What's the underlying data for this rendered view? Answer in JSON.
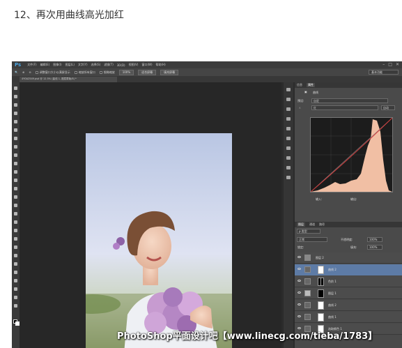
{
  "heading": "12、再次用曲线高光加红",
  "ps": {
    "logo": "Ps",
    "menu": [
      "文件(F)",
      "编辑(E)",
      "图像(I)",
      "图层(L)",
      "文字(Y)",
      "选择(S)",
      "滤镜(T)",
      "3D(D)",
      "视图(V)",
      "窗口(W)",
      "帮助(H)"
    ],
    "window_buttons": [
      "–",
      "□",
      "✕"
    ],
    "options": {
      "check1": "调整窗口大小以满屏显示",
      "check2": "缩放所有窗口",
      "check3": "细微缩放",
      "btn1": "100%",
      "btn2": "适合屏幕",
      "btn3": "填充屏幕",
      "workspace": "基本功能"
    },
    "doc_tab": "4Y0A2549.psd @ 12.5% (曲线 1, 图层蒙版/8) *",
    "properties": {
      "tabs": [
        "信息",
        "属性"
      ],
      "title": "曲线",
      "preset_label": "预设:",
      "preset_value": "自定",
      "channel_value": "红",
      "auto_button": "自动",
      "input_label": "输入:",
      "output_label": "输出:"
    },
    "layers": {
      "tabs": [
        "图层",
        "通道",
        "路径"
      ],
      "filter": "ρ 类型",
      "blend": "正常",
      "opacity_label": "不透明度:",
      "opacity": "100%",
      "lock_label": "锁定:",
      "fill_label": "填充:",
      "fill": "100%",
      "items": [
        {
          "name": "图层 2"
        },
        {
          "name": "曲线 2"
        },
        {
          "name": "色阶 1"
        },
        {
          "name": "图层 1"
        },
        {
          "name": "曲线 2"
        },
        {
          "name": "曲线 1"
        },
        {
          "name": "选取颜色 1"
        }
      ]
    }
  },
  "watermark": "PhotoShop平面设计吧【www.linecg.com/tieba/1783】"
}
